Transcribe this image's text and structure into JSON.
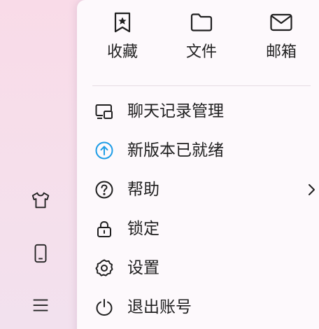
{
  "colors": {
    "accent_blue": "#1e9de6",
    "text": "#1f1f1f"
  },
  "sidebar": {
    "icons": [
      "skin-icon",
      "phone-icon",
      "menu-icon"
    ]
  },
  "quick_actions": [
    {
      "label": "收藏",
      "icon": "bookmark-icon"
    },
    {
      "label": "文件",
      "icon": "folder-icon"
    },
    {
      "label": "邮箱",
      "icon": "mail-icon"
    }
  ],
  "menu": {
    "items": [
      {
        "label": "聊天记录管理",
        "icon": "chat-history-icon"
      },
      {
        "label": "新版本已就绪",
        "icon": "update-icon"
      },
      {
        "label": "帮助",
        "icon": "help-icon",
        "has_submenu": true
      },
      {
        "label": "锁定",
        "icon": "lock-icon"
      },
      {
        "label": "设置",
        "icon": "gear-icon"
      },
      {
        "label": "退出账号",
        "icon": "power-icon"
      }
    ]
  }
}
